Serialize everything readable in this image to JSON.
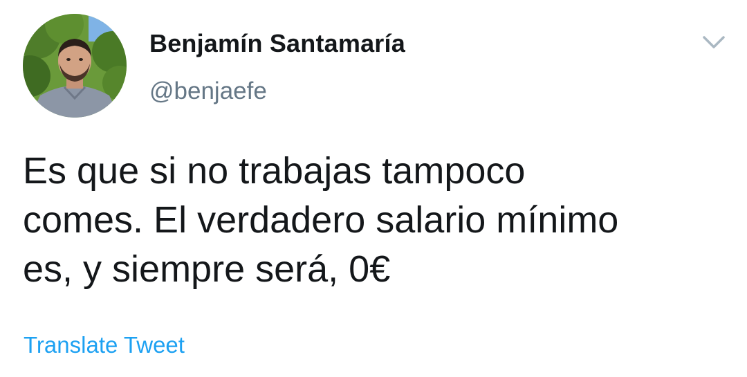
{
  "tweet": {
    "author": {
      "display_name": "Benjamín Santamaría",
      "handle": "@benjaefe",
      "avatar_icon": "profile-photo"
    },
    "text_lines": [
      "Es que si no trabajas tampoco",
      "comes. El verdadero salario mínimo",
      "es, y siempre será, 0€"
    ],
    "translate_label": "Translate Tweet",
    "menu_icon": "chevron-down-icon"
  },
  "colors": {
    "text": "#14171a",
    "secondary": "#657786",
    "link": "#1da1f2",
    "chevron": "#aab8c2"
  }
}
